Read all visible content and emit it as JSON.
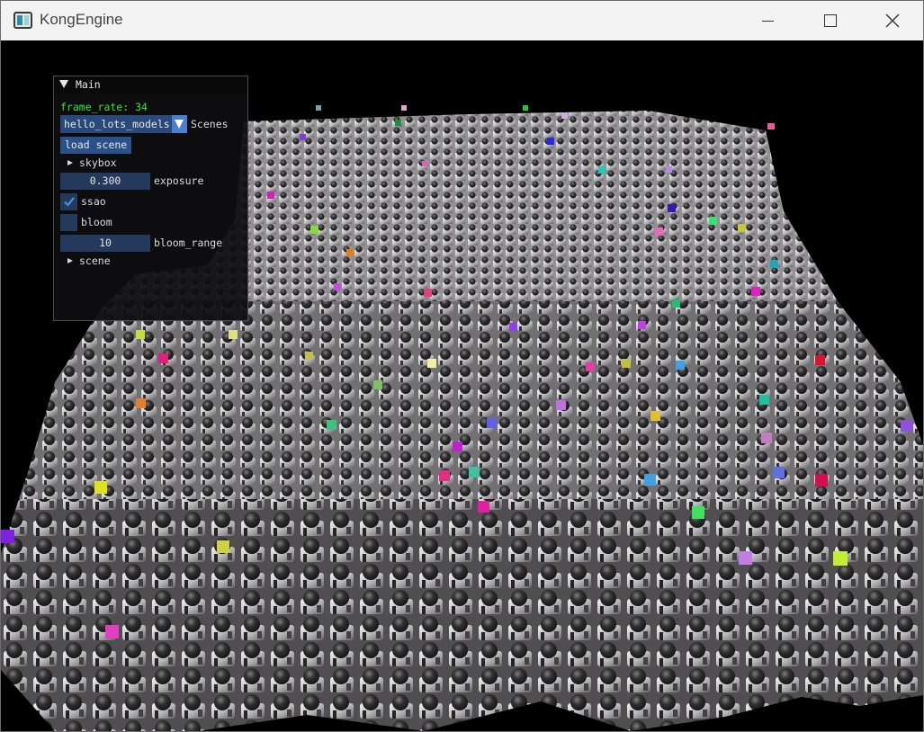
{
  "window": {
    "title": "KongEngine",
    "icon": "app-window-icon",
    "controls": [
      "minimize-icon",
      "maximize-icon",
      "close-icon"
    ]
  },
  "scene_view": {
    "description_icon": "3d-viewport",
    "background": "#000000"
  },
  "imgui": {
    "title": "Main",
    "frame_rate": "frame_rate: 34",
    "scene_combo": {
      "selected": "hello_lots_models",
      "label": "Scenes"
    },
    "load_button": "load scene",
    "skybox_tree": "skybox",
    "exposure": {
      "value": "0.300",
      "label": "exposure"
    },
    "ssao": {
      "checked": true,
      "label": "ssao"
    },
    "bloom": {
      "checked": false,
      "label": "bloom"
    },
    "bloom_range": {
      "value": "10",
      "label": "bloom_range"
    },
    "scene_tree": "scene",
    "colors": {
      "frame_rate": "#2fe82f",
      "combo_bg": "#29497a",
      "combo_arrow": "#4a7fd0",
      "button_bg": "#2a5189",
      "frame_bg": "#243a5c",
      "check": "#4a8fe8"
    }
  }
}
